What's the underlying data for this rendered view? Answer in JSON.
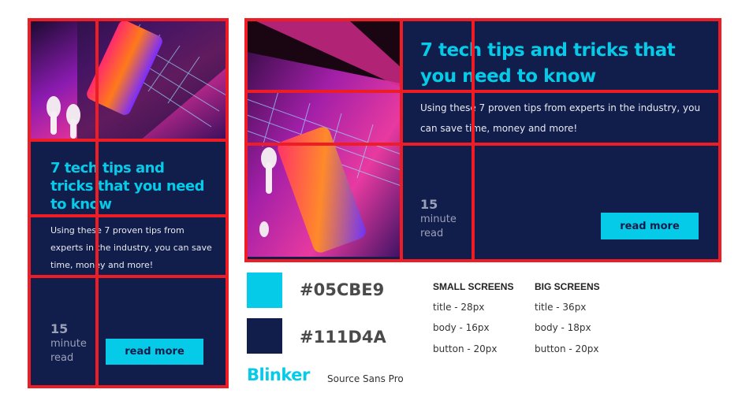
{
  "small_card": {
    "title": "7 tech tips and tricks that you need to know",
    "body": "Using these 7 proven tips from experts in the industry, you can save time, money and more!",
    "minutes_num": "15",
    "minutes_unit": "minute",
    "minutes_read": "read",
    "button": "read more"
  },
  "big_card": {
    "title": "7 tech tips and tricks that you need to know",
    "body": "Using these 7 proven tips from experts in the industry, you can save time, money and more!",
    "minutes_num": "15",
    "minutes_unit": "minute",
    "minutes_read": "read",
    "button": "read more"
  },
  "palette": {
    "accent": "#05CBE9",
    "dark": "#111D4A",
    "accent_label": "#05CBE9",
    "dark_label": "#111D4A"
  },
  "fonts": {
    "heading_font_label": "Blinker",
    "body_font_label": "Source Sans Pro"
  },
  "specs": {
    "small": {
      "heading": "SMALL SCREENS",
      "title": "title - 28px",
      "body": "body - 16px",
      "button": "button - 20px"
    },
    "big": {
      "heading": "BIG SCREENS",
      "title": "title - 36px",
      "body": "body - 18px",
      "button": "button - 20px"
    }
  }
}
